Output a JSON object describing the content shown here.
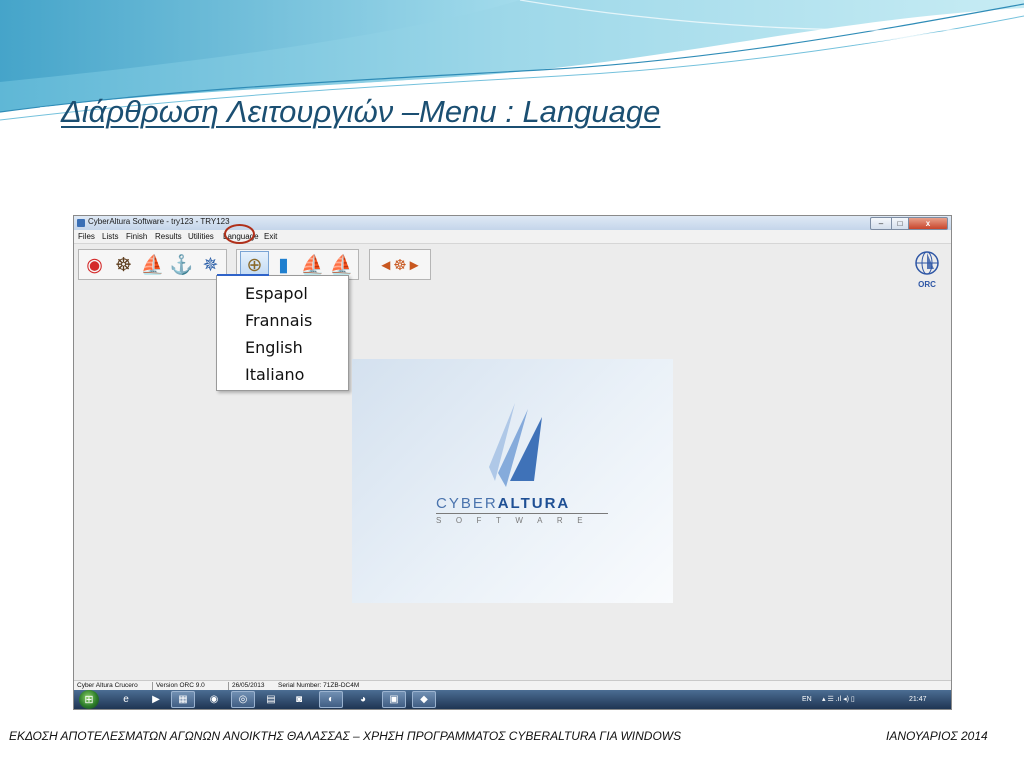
{
  "slide": {
    "title": "Διάρθρωση Λειτουργιών –Menu : Language",
    "footer_left": "ΕΚΔΟΣΗ ΑΠΟΤΕΛΕΣΜΑΤΩΝ ΑΓΩΝΩΝ ΑΝΟΙΚΤΗΣ ΘΑΛΑΣΣΑΣ – ΧΡΗΣΗ ΠΡΟΓΡΑΜΜΑΤΟΣ CYBERALTURA ΓΙΑ WINDOWS",
    "footer_right": "ΙΑΝΟΥΑΡΙΟΣ 2014"
  },
  "window": {
    "title": "CyberAltura Software  - try123 - TRY123",
    "minimize": "–",
    "maximize": "□",
    "close": "x"
  },
  "menu": {
    "files": "Files",
    "lists": "Lists",
    "finish": "Finish",
    "results": "Results",
    "utilities": "Utilities",
    "language": "Language",
    "exit": "Exit"
  },
  "toolbar": {
    "icons": [
      "lifebuoy-icon",
      "ship-wheel-icon",
      "sailboat-icon",
      "anchor-icon",
      "compass-rose-icon",
      "compass-icon",
      "book-icon",
      "sailboat-small-icon",
      "regatta-icon",
      "navigation-arrows-icon"
    ],
    "glyphs": {
      "lifebuoy": "◉",
      "wheel": "☸",
      "sailboat": "⛵",
      "anchor": "⚓",
      "rose": "✵",
      "compass": "⊕",
      "book": "▮",
      "sailboat_small": "⛵",
      "regatta": "⛵",
      "arrows": "◄☸►"
    }
  },
  "orc_logo": {
    "text": "ORC"
  },
  "language_menu": {
    "items": [
      "Espapol",
      "Frannais",
      "English",
      "Italiano"
    ]
  },
  "splash": {
    "brand_part1": "CYBER",
    "brand_part2": "ALTURA",
    "tagline": "SOFTWARE"
  },
  "status": {
    "product": "Cyber Altura Crucero",
    "version": "Version ORC 9.0",
    "date": "26/05/2013",
    "serial": "Serial Number: 71ZB-DC4M"
  },
  "taskbar": {
    "start": "⊞",
    "apps": [
      "e",
      "▶",
      "▦",
      "◉",
      "◎",
      "▤",
      "◙",
      "◐",
      "◕",
      "▣",
      "◆"
    ],
    "lang": "EN",
    "tray_icons": "▴ ☰ .ıl ◂) ▯",
    "time": "21:47"
  },
  "colors": {
    "title": "#1b4f72",
    "language_highlight": "#b0301a",
    "taskbar": "#2a4466",
    "menu_accent": "#2f63c9"
  }
}
